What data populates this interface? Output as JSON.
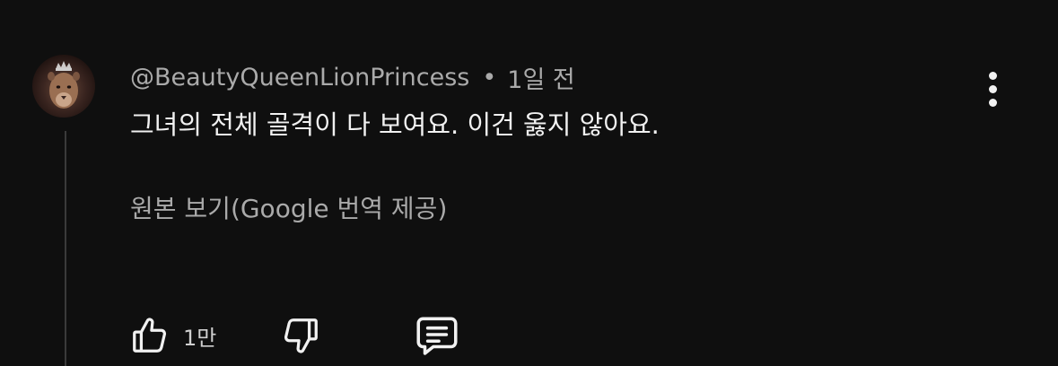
{
  "comment": {
    "author_handle": "@BeautyQueenLionPrincess",
    "separator": "•",
    "timestamp": "1일 전",
    "text": "그녀의 전체 골격이 다 보여요. 이건 옳지 않아요.",
    "translation_link": "원본 보기(Google 번역 제공)",
    "like_count": "1만"
  },
  "icons": {
    "avatar": "lion-with-crown-avatar",
    "more": "vertical-ellipsis-icon",
    "like": "thumbs-up-icon",
    "dislike": "thumbs-down-icon",
    "reply": "comment-bubble-icon"
  },
  "colors": {
    "background": "#0f0f0f",
    "primary_text": "#f1f1f1",
    "secondary_text": "#aaaaaa",
    "thread_line": "#3a3a3a"
  }
}
